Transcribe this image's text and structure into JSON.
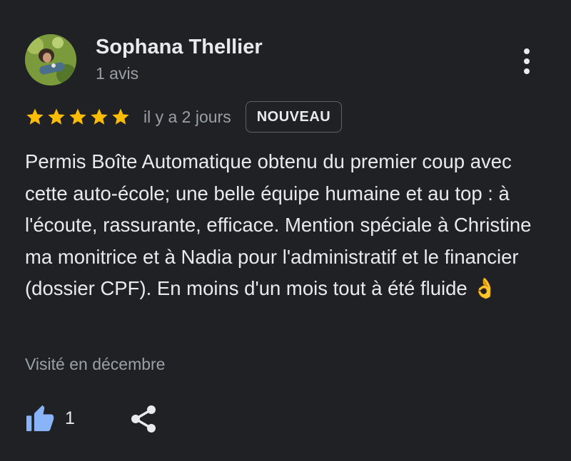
{
  "reviewer": {
    "name": "Sophana Thellier",
    "review_count": "1 avis"
  },
  "review": {
    "rating": 5,
    "max_rating": 5,
    "date": "il y a 2 jours",
    "badge": "NOUVEAU",
    "text": "Permis Boîte Automatique obtenu du premier coup avec cette auto-école; une belle équipe humaine et au top : à l'écoute, rassurante, efficace. Mention spéciale à Christine ma monitrice et à Nadia pour l'administratif et le financier (dossier CPF). En moins d'un mois tout à été fluide 👌",
    "visited": "Visité en décembre"
  },
  "actions": {
    "like_count": "1"
  },
  "icons": {
    "more": "more-vert-icon",
    "star": "star-icon",
    "like": "thumbs-up-icon",
    "share": "share-icon"
  },
  "colors": {
    "background": "#202124",
    "star": "#fbbc04",
    "like": "#8ab4f8",
    "text_primary": "#e8eaed",
    "text_secondary": "#9aa0a6"
  }
}
